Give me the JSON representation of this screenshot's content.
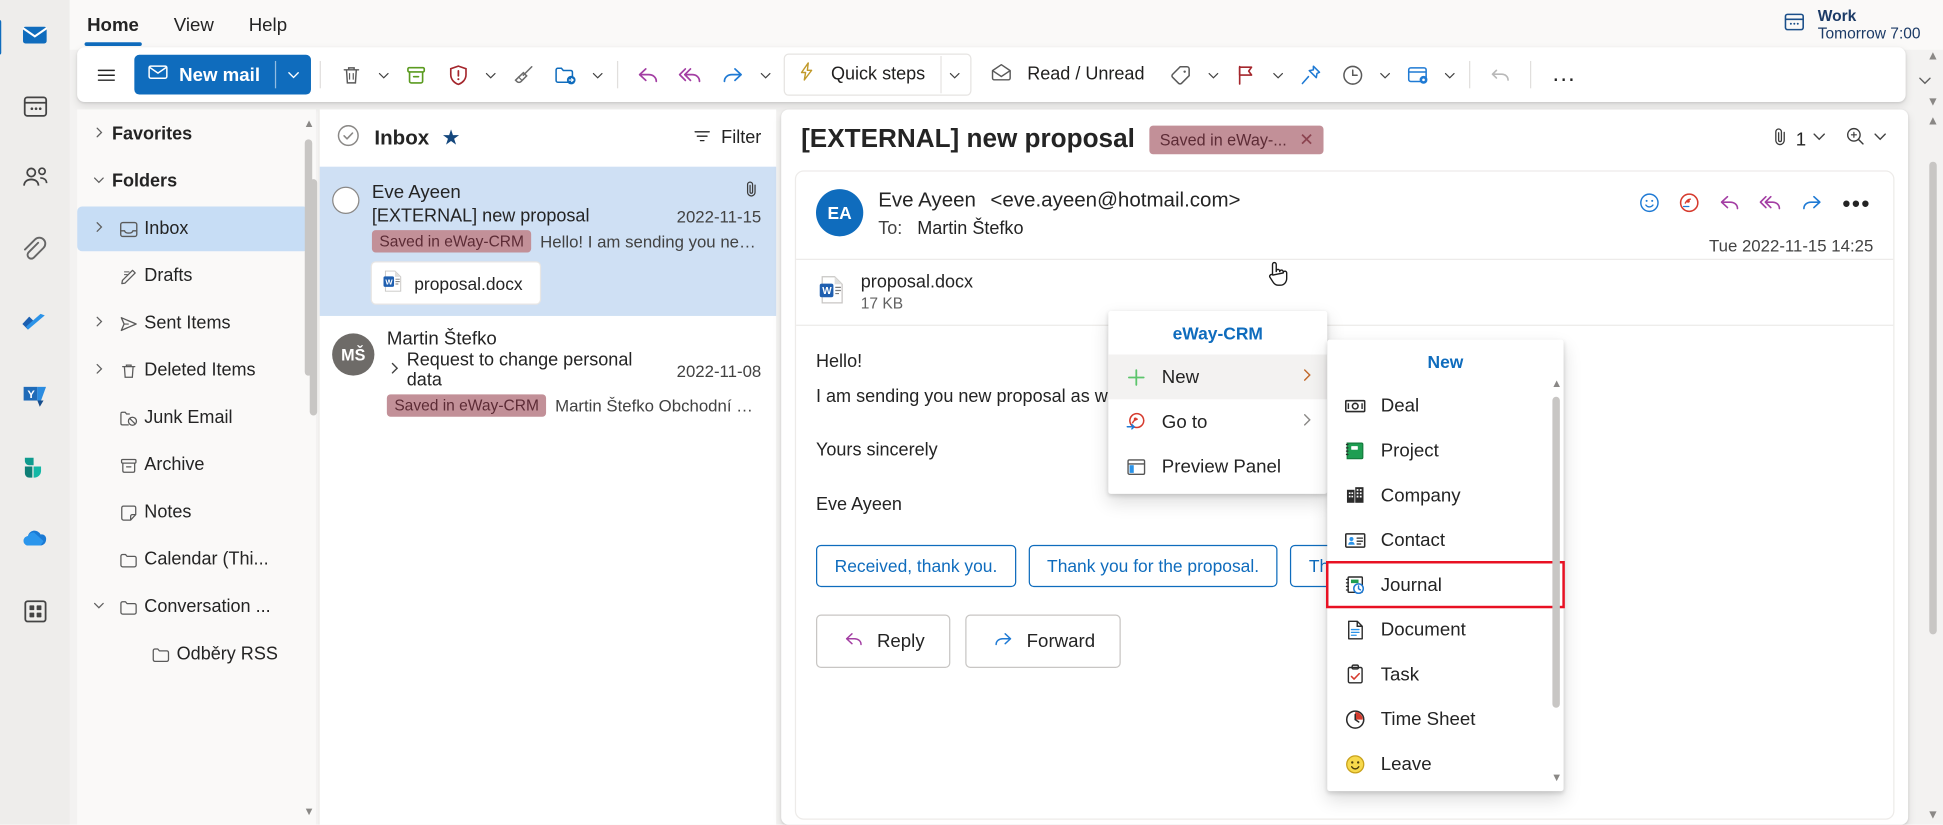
{
  "app_rail": [
    {
      "name": "mail-icon",
      "label": "Mail",
      "active": true
    },
    {
      "name": "calendar-icon",
      "label": "Calendar",
      "active": false
    },
    {
      "name": "people-icon",
      "label": "People",
      "active": false
    },
    {
      "name": "paperclip-files-icon",
      "label": "Files",
      "active": false
    },
    {
      "name": "to-do-icon",
      "label": "To Do",
      "active": false
    },
    {
      "name": "yammer-icon",
      "label": "Yammer",
      "active": false
    },
    {
      "name": "bookings-icon",
      "label": "Bookings",
      "active": false
    },
    {
      "name": "onedrive-icon",
      "label": "OneDrive",
      "active": false
    },
    {
      "name": "app-launcher-icon",
      "label": "More apps",
      "active": false
    }
  ],
  "tabs": [
    {
      "label": "Home",
      "active": true
    },
    {
      "label": "View",
      "active": false
    },
    {
      "label": "Help",
      "active": false
    }
  ],
  "meeting": {
    "title": "Work",
    "subtitle": "Tomorrow 7:00"
  },
  "ribbon": {
    "hamburger_label": "Menu",
    "new_mail_label": "New mail",
    "delete_label": "Delete",
    "archive_label": "Archive",
    "report_label": "Report",
    "sweep_label": "Sweep",
    "move_to_label": "Move to",
    "reply_label": "Reply",
    "reply_all_label": "Reply all",
    "forward_label": "Forward",
    "quick_steps_label": "Quick steps",
    "read_unread_label": "Read / Unread",
    "categorize_label": "Categorize",
    "flag_label": "Flag",
    "pin_label": "Pin",
    "snooze_label": "Snooze",
    "rules_label": "Rules",
    "undo_label": "Undo",
    "more_label": "..."
  },
  "folders": [
    {
      "label": "Favorites",
      "icon": "",
      "chevron": ">",
      "indent": 0,
      "head": true,
      "selected": false
    },
    {
      "label": "Folders",
      "icon": "",
      "chevron": "v",
      "indent": 0,
      "head": true,
      "selected": false
    },
    {
      "label": "Inbox",
      "icon": "inbox-icon",
      "chevron": ">",
      "indent": 1,
      "head": false,
      "selected": true
    },
    {
      "label": "Drafts",
      "icon": "drafts-pencil-icon",
      "chevron": "",
      "indent": 1,
      "head": false,
      "selected": false
    },
    {
      "label": "Sent Items",
      "icon": "sent-plane-icon",
      "chevron": ">",
      "indent": 1,
      "head": false,
      "selected": false
    },
    {
      "label": "Deleted Items",
      "icon": "trash-icon",
      "chevron": ">",
      "indent": 1,
      "head": false,
      "selected": false
    },
    {
      "label": "Junk Email",
      "icon": "junk-folder-icon",
      "chevron": "",
      "indent": 1,
      "head": false,
      "selected": false
    },
    {
      "label": "Archive",
      "icon": "archive-box-icon",
      "chevron": "",
      "indent": 1,
      "head": false,
      "selected": false
    },
    {
      "label": "Notes",
      "icon": "note-icon",
      "chevron": "",
      "indent": 1,
      "head": false,
      "selected": false
    },
    {
      "label": "Calendar (Thi...",
      "icon": "folder-icon",
      "chevron": "",
      "indent": 1,
      "head": false,
      "selected": false
    },
    {
      "label": "Conversation ...",
      "icon": "folder-icon",
      "chevron": "v",
      "indent": 1,
      "head": false,
      "selected": false
    },
    {
      "label": "Odběry RSS",
      "icon": "folder-icon",
      "chevron": "",
      "indent": 2,
      "head": false,
      "selected": false
    }
  ],
  "message_list": {
    "header_title": "Inbox",
    "header_star": "★",
    "filter_label": "Filter",
    "messages": [
      {
        "from": "Eve Ayeen",
        "subject": "[EXTERNAL] new proposal",
        "date": "2022-11-15",
        "badge": "Saved in eWay-CRM",
        "preview": "Hello! I am sending you new...",
        "attachment": "proposal.docx",
        "avatar_initials": "",
        "selected": true,
        "has_attachment_icon": true
      },
      {
        "from": "Martin Štefko",
        "subject": "Request to change personal data",
        "date": "2022-11-08",
        "badge": "Saved in eWay-CRM",
        "preview": "Martin Štefko Obchodní odd...",
        "attachment": "",
        "avatar_initials": "MŠ",
        "selected": false,
        "has_attachment_icon": false
      }
    ]
  },
  "reading_pane": {
    "title": "[EXTERNAL] new proposal",
    "badge": "Saved in eWay-...",
    "badge_close": "✕",
    "attachment_count": "1",
    "sender_name": "Eve Ayeen",
    "sender_email": "<eve.ayeen@hotmail.com>",
    "to_label": "To:",
    "to_value": "Martin Štefko",
    "avatar_initials": "EA",
    "timestamp": "Tue 2022-11-15 14:25",
    "attachment_name": "proposal.docx",
    "attachment_size": "17 KB",
    "body_lines": [
      "Hello!",
      "I am sending you new proposal as we agreed.",
      "",
      "Yours sincerely",
      "",
      "Eve Ayeen"
    ],
    "suggestions": [
      "Received, thank you.",
      "Thank you for the proposal.",
      "Thank you!"
    ],
    "reply_label": "Reply",
    "forward_label": "Forward"
  },
  "context_menu": {
    "title": "eWay-CRM",
    "items": [
      {
        "label": "New",
        "icon": "plus-icon",
        "submenu": true,
        "hover": true
      },
      {
        "label": "Go to",
        "icon": "eway-goto-icon",
        "submenu": true,
        "hover": false
      },
      {
        "label": "Preview Panel",
        "icon": "preview-panel-icon",
        "submenu": false,
        "hover": false
      }
    ]
  },
  "submenu": {
    "title": "New",
    "items": [
      {
        "label": "Deal",
        "icon": "deal-money-icon",
        "highlight": false
      },
      {
        "label": "Project",
        "icon": "project-book-icon",
        "highlight": false
      },
      {
        "label": "Company",
        "icon": "company-building-icon",
        "highlight": false
      },
      {
        "label": "Contact",
        "icon": "contact-card-icon",
        "highlight": false
      },
      {
        "label": "Journal",
        "icon": "journal-clock-icon",
        "highlight": true
      },
      {
        "label": "Document",
        "icon": "document-page-icon",
        "highlight": false
      },
      {
        "label": "Task",
        "icon": "task-clipboard-icon",
        "highlight": false
      },
      {
        "label": "Time Sheet",
        "icon": "time-sheet-clock-icon",
        "highlight": false
      },
      {
        "label": "Leave",
        "icon": "leave-smiley-icon",
        "highlight": false
      }
    ]
  },
  "colors": {
    "accent": "#0f6cbd",
    "selection": "#cfe0f4",
    "crm_badge_bg": "#c29098",
    "crm_badge_text": "#5c2b35",
    "highlight_box": "#e81123"
  }
}
